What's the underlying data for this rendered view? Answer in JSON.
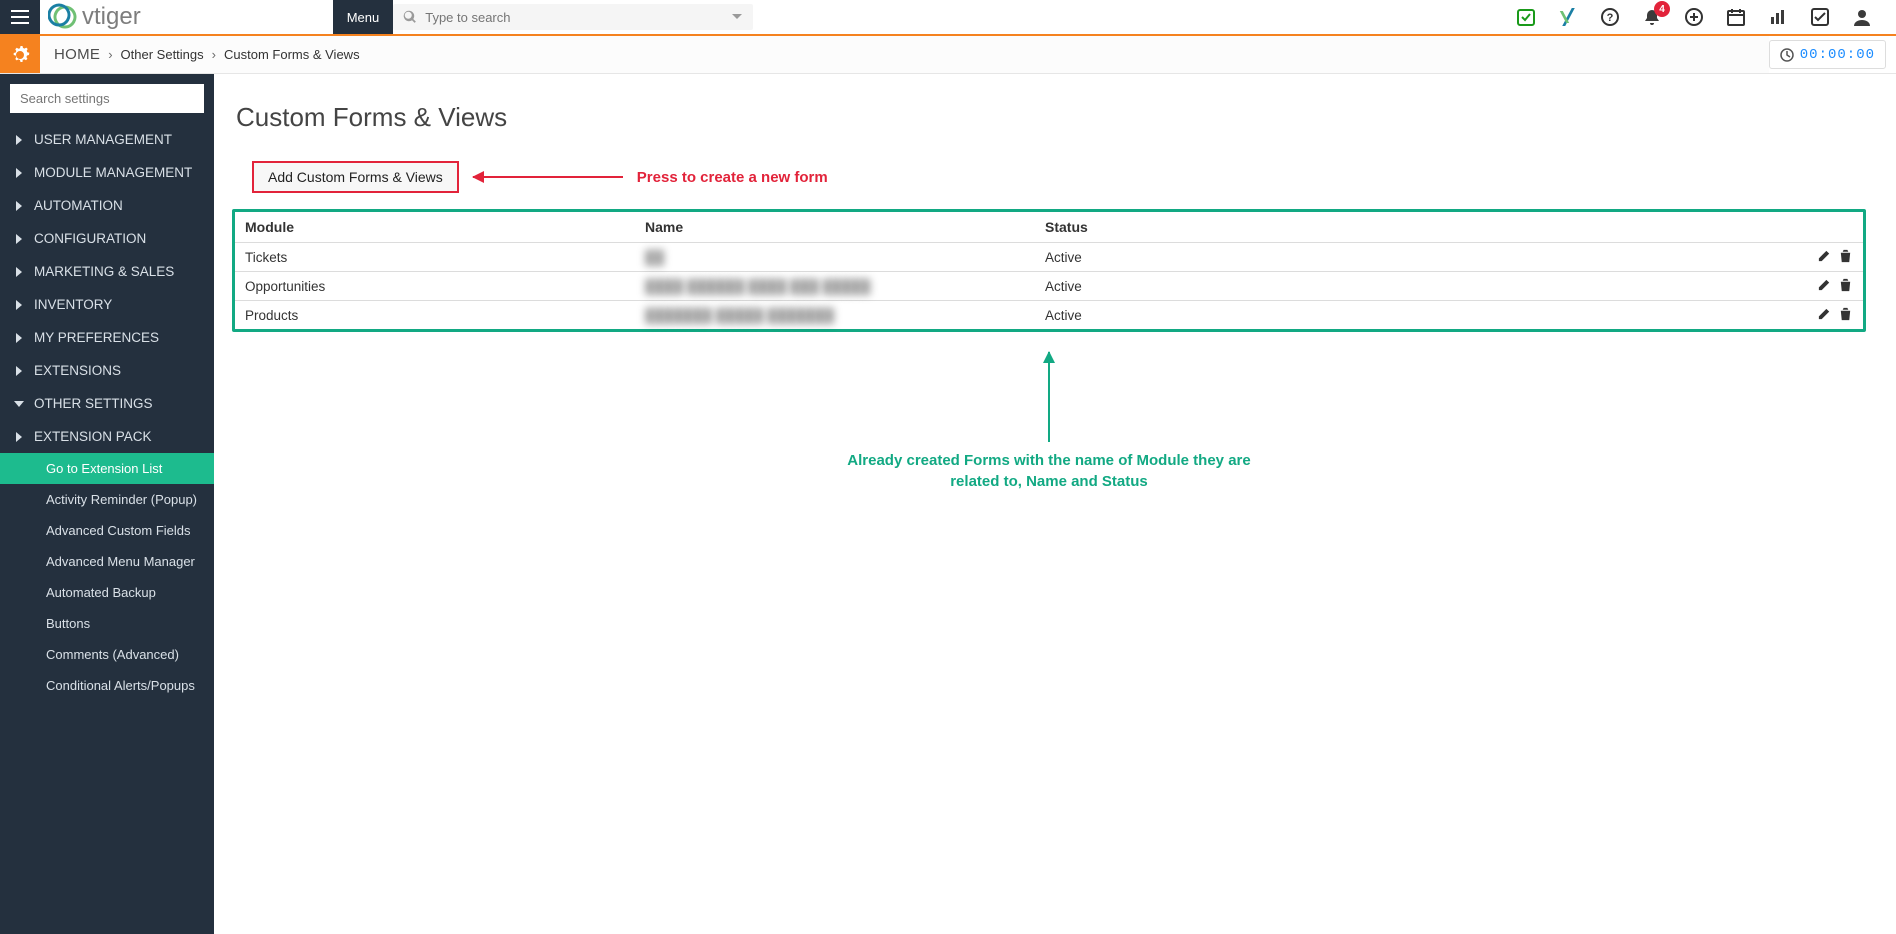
{
  "top": {
    "menu_label": "Menu",
    "search_placeholder": "Type to search",
    "notifications_count": "4",
    "timer": "00:00:00"
  },
  "breadcrumb": {
    "home": "HOME",
    "level1": "Other Settings",
    "level2": "Custom Forms & Views"
  },
  "sidebar": {
    "search_placeholder": "Search settings",
    "items": [
      "USER MANAGEMENT",
      "MODULE MANAGEMENT",
      "AUTOMATION",
      "CONFIGURATION",
      "MARKETING & SALES",
      "INVENTORY",
      "MY PREFERENCES",
      "EXTENSIONS",
      "OTHER SETTINGS",
      "EXTENSION PACK"
    ],
    "subitems": [
      "Go to Extension List",
      "Activity Reminder (Popup)",
      "Advanced Custom Fields",
      "Advanced Menu Manager",
      "Automated Backup",
      "Buttons",
      "Comments (Advanced)",
      "Conditional Alerts/Popups"
    ]
  },
  "page": {
    "title": "Custom Forms & Views",
    "add_button": "Add Custom Forms & Views",
    "callout_add": "Press to create a new form",
    "callout_table_l1": "Already created Forms with the name of Module they are",
    "callout_table_l2": "related to, Name and Status"
  },
  "table": {
    "headers": {
      "module": "Module",
      "name": "Name",
      "status": "Status"
    },
    "rows": [
      {
        "module": "Tickets",
        "name": "██",
        "status": "Active"
      },
      {
        "module": "Opportunities",
        "name": "████ ██████ ████ ███ █████",
        "status": "Active"
      },
      {
        "module": "Products",
        "name": "███████ █████ ███████",
        "status": "Active"
      }
    ]
  }
}
